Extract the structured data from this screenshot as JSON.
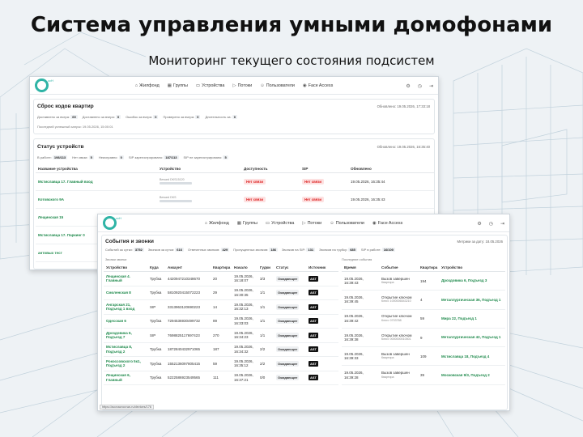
{
  "slide": {
    "title": "Система управления умными домофонами",
    "subtitle": "Мониторинг текущего состояния подсистем"
  },
  "nav": {
    "logo_text": "ccH",
    "items": [
      {
        "label": "Жилфонд",
        "icon": "home-icon"
      },
      {
        "label": "Группы",
        "icon": "grid-icon"
      },
      {
        "label": "Устройства",
        "icon": "devices-icon"
      },
      {
        "label": "Потоки",
        "icon": "video-icon"
      },
      {
        "label": "Пользователи",
        "icon": "users-icon"
      },
      {
        "label": "Face Access",
        "icon": "face-icon"
      }
    ]
  },
  "back": {
    "reset": {
      "title": "Сброс кодов квартир",
      "updated": "Обновлено: 19.05.2026, 17:33:18",
      "chips": [
        {
          "label": "Доставлено за вчера:",
          "value": "69"
        },
        {
          "label": "Доставлено за вчера:",
          "value": "0"
        },
        {
          "label": "Ошибок за вчера:",
          "value": "0"
        },
        {
          "label": "Проверено за вчера:",
          "value": "0"
        },
        {
          "label": "Длительность за:",
          "value": "0"
        }
      ],
      "last_run": "Последний успешный запуск: 19.05.2026, 15:00:01"
    },
    "status": {
      "title": "Статус устройств",
      "updated": "Обновлено: 19.05.2026, 16:35:40",
      "chips": [
        {
          "label": "В работе:",
          "value": "198/113"
        },
        {
          "label": "Нет связи:",
          "value": "5"
        },
        {
          "label": "Неисправно:",
          "value": "0"
        },
        {
          "label": "SIP зарегистрировано:",
          "value": "187/113"
        },
        {
          "label": "SIP не зарегистрировано:",
          "value": "5"
        }
      ],
      "columns": [
        "Название устройства",
        "Устройство",
        "Доступность",
        "SIP",
        "Обновлено"
      ],
      "rows": [
        {
          "name": "Мстиславца 17. Главный вход",
          "device": "Beward DKS15120",
          "avail": "Нет связи",
          "sip": "Нет связи",
          "updated": "19.05.2026, 16:35:44"
        },
        {
          "name": "Котовского 9А",
          "device": "Beward DKS",
          "avail": "Нет связи",
          "sip": "Нет связи",
          "updated": "19.05.2026, 16:35:43"
        },
        {
          "name": "Лещинская 15",
          "device": "",
          "avail": "",
          "sip": "",
          "updated": ""
        },
        {
          "name": "Мстиславца 17. Паркинг 0",
          "device": "",
          "avail": "",
          "sip": "",
          "updated": ""
        },
        {
          "name": "антовых тест",
          "device": "",
          "avail": "",
          "sip": "",
          "updated": ""
        }
      ]
    }
  },
  "front": {
    "title": "События и звонки",
    "metrics_label": "Метрики за дату: 18.05.2026",
    "chips": [
      {
        "label": "Событий за сутки:",
        "value": "3752"
      },
      {
        "label": "Звонков за сутки:",
        "value": "616"
      },
      {
        "label": "Отвеченных звонков:",
        "value": "429"
      },
      {
        "label": "Пропущенных звонков:",
        "value": "186"
      },
      {
        "label": "Звонков на SIP:",
        "value": "131"
      },
      {
        "label": "Звонков на трубку:",
        "value": "685"
      },
      {
        "label": "SIP в работе:",
        "value": "16/100"
      }
    ],
    "left_caption": "Звонки звонки",
    "right_caption": "Последние события",
    "calls_columns": [
      "Устройство",
      "Куда",
      "Аккаунт",
      "Квартира",
      "Начало",
      "Гудки",
      "Статус",
      "Источник"
    ],
    "calls": [
      {
        "device": "Лещинская 4. Главный",
        "to": "Трубка",
        "account": "4420947210348670",
        "apt": "20",
        "start": "19.05.2026, 16:18:07",
        "rings": "3/3",
        "status": "Ожидающее",
        "source": "AST"
      },
      {
        "device": "Смоленская 8",
        "to": "Трубка",
        "account": "5810920415072223",
        "apt": "29",
        "start": "19.05.2026, 16:30:35",
        "rings": "1/1",
        "status": "Ожидающее",
        "source": "AST"
      },
      {
        "device": "Ангарская 21, Подъезд 1 вход",
        "to": "SIP",
        "account": "3313963120690223",
        "apt": "14",
        "start": "19.05.2026, 16:32:13",
        "rings": "1/1",
        "status": "Ожидающее",
        "source": "AST"
      },
      {
        "device": "Одесская 6",
        "to": "Трубка",
        "account": "7294536930499732",
        "apt": "89",
        "start": "19.05.2026, 16:33:03",
        "rings": "1/1",
        "status": "Ожидающее",
        "source": "AST"
      },
      {
        "device": "Дроздовика 6, Подъезд 7",
        "to": "SIP",
        "account": "7698825117697423",
        "apt": "270",
        "start": "19.05.2026, 16:34:23",
        "rings": "1/1",
        "status": "Ожидающее",
        "source": "AST"
      },
      {
        "device": "Мстиславца 8, Подъезд 2",
        "to": "Трубка",
        "account": "1872840432971065",
        "apt": "187",
        "start": "19.05.2026, 16:34:32",
        "rings": "2/2",
        "status": "Ожидающее",
        "source": "AST"
      },
      {
        "device": "Рокоссовского 5к1, Подъезд 2",
        "to": "Трубка",
        "account": "1552136097805415",
        "apt": "59",
        "start": "19.05.2026, 16:35:12",
        "rings": "2/2",
        "status": "Ожидающее",
        "source": "AST"
      },
      {
        "device": "Лещинская 6, Главный",
        "to": "Трубка",
        "account": "5222586923549565",
        "apt": "111",
        "start": "19.05.2026, 16:37:21",
        "rings": "0/0",
        "status": "Ожидающее",
        "source": "AST"
      }
    ],
    "events_columns": [
      "Время",
      "Событие",
      "Квартира",
      "Устройство"
    ],
    "events": [
      {
        "time": "19.05.2026, 16:39:43",
        "event": "Вызов завершен",
        "sub": "Квартира",
        "apt": "194",
        "device": "Дроздовика 6, Подъезд 3"
      },
      {
        "time": "19.05.2026, 16:39:45",
        "event": "Открытие ключом",
        "sub": "Ключ: 1000006543210",
        "apt": "4",
        "device": "Металлургическая 36, Подъезд 1"
      },
      {
        "time": "19.05.2026, 16:39:42",
        "event": "Открытие ключом",
        "sub": "Ключ: 0703788",
        "apt": "59",
        "device": "Мира 22, Подъезд 1"
      },
      {
        "time": "19.05.2026, 16:39:38",
        "event": "Открытие ключом",
        "sub": "Ключ: 0000000010501",
        "apt": "9",
        "device": "Металлургическая 42, Подъезд 1"
      },
      {
        "time": "19.05.2026, 16:39:33",
        "event": "Вызов завершен",
        "sub": "Квартира",
        "apt": "109",
        "device": "Мстиславца 18, Подъезд 4"
      },
      {
        "time": "19.05.2026, 16:39:28",
        "event": "Вызов завершен",
        "sub": "Квартира",
        "apt": "39",
        "device": "Московская 9/3, Подъезд 2"
      }
    ],
    "url_tip": "https://aconacnov.ws.ru/devices/176"
  }
}
